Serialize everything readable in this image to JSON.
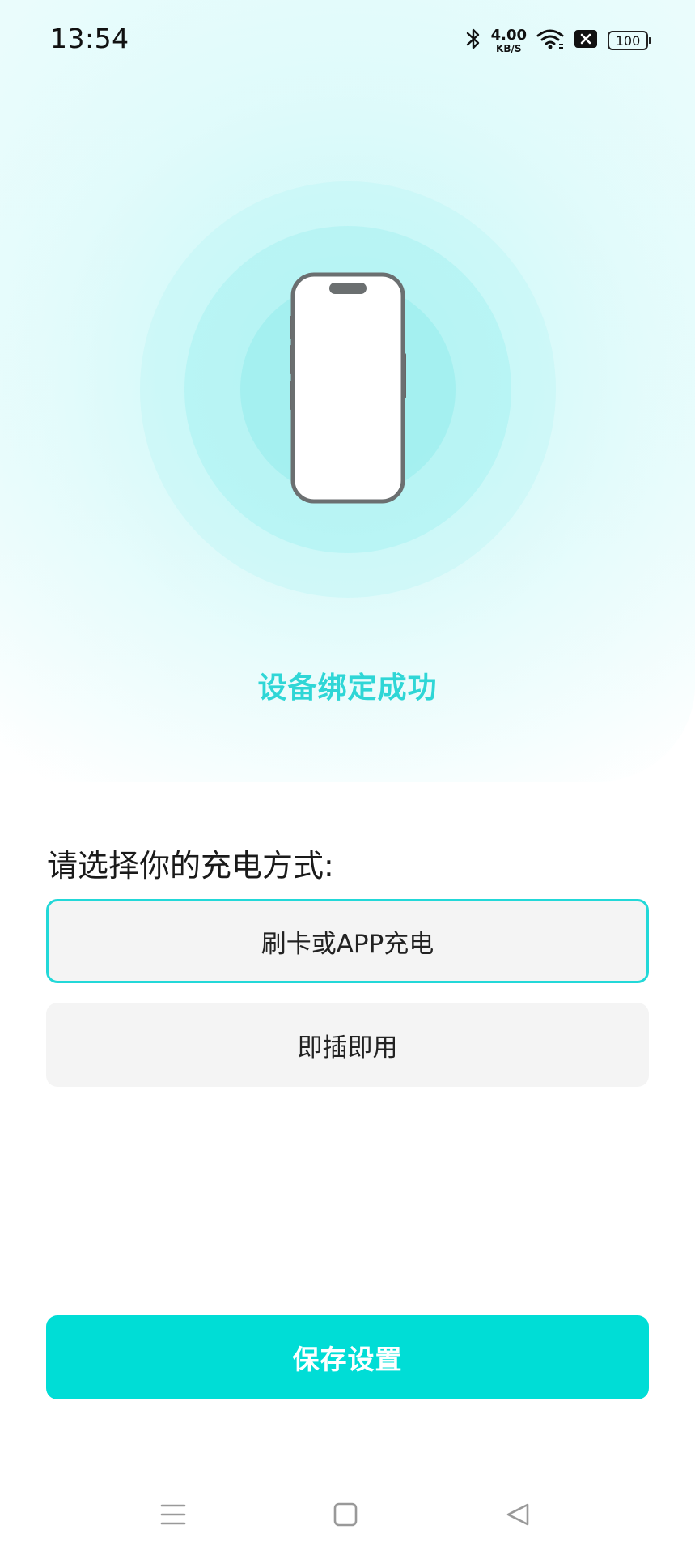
{
  "status_bar": {
    "time": "13:54",
    "net_speed_value": "4.00",
    "net_speed_unit": "KB/S",
    "battery": "100",
    "icons": [
      "bluetooth-icon",
      "wifi-icon",
      "no-sim-icon",
      "battery-icon"
    ]
  },
  "illustration": {
    "icon": "phone-icon",
    "accent_color": "#2fd6d6"
  },
  "main": {
    "bind_status": "设备绑定成功",
    "charge_prompt": "请选择你的充电方式:",
    "options": [
      {
        "label": "刷卡或APP充电",
        "selected": true
      },
      {
        "label": "即插即用",
        "selected": false
      }
    ],
    "save_label": "保存设置",
    "save_color": "#00ddd6"
  },
  "nav_bar": {
    "buttons": [
      "menu-icon",
      "home-icon",
      "back-icon"
    ]
  }
}
